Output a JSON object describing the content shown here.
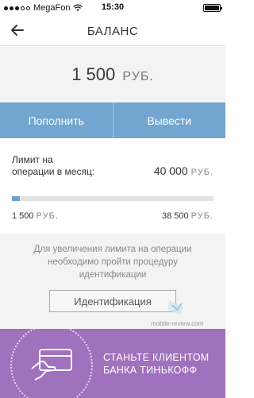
{
  "status_bar": {
    "carrier": "MegaFon",
    "time": "15:30"
  },
  "header": {
    "title": "БАЛАНС"
  },
  "balance": {
    "amount": "1 500",
    "currency": "РУБ."
  },
  "actions": {
    "topup_label": "Пополнить",
    "withdraw_label": "Вывести"
  },
  "limit": {
    "label_line1": "Лимит на",
    "label_line2": "операции в месяц:",
    "amount": "40 000",
    "currency": "РУБ.",
    "used_amount": "1 500",
    "used_currency": "РУБ.",
    "remaining_amount": "38 500",
    "remaining_currency": "РУБ.",
    "progress_fraction": 0.0375
  },
  "identification": {
    "line1": "Для увеличения лимита на операции",
    "line2": "необходимо пройти процедуру",
    "line3": "идентификации",
    "button_label": "Идентификация"
  },
  "promo": {
    "line1": "СТАНЬТЕ КЛИЕНТОМ",
    "line2": "БАНКА ТИНЬКОФФ"
  },
  "watermark": "mobile-review.com",
  "colors": {
    "accent_blue": "#72a5cf",
    "promo_purple": "#a071bc",
    "progress": "#6da1cc"
  },
  "icons": [
    "back-arrow-icon",
    "wifi-icon",
    "battery-icon",
    "card-hand-icon"
  ]
}
